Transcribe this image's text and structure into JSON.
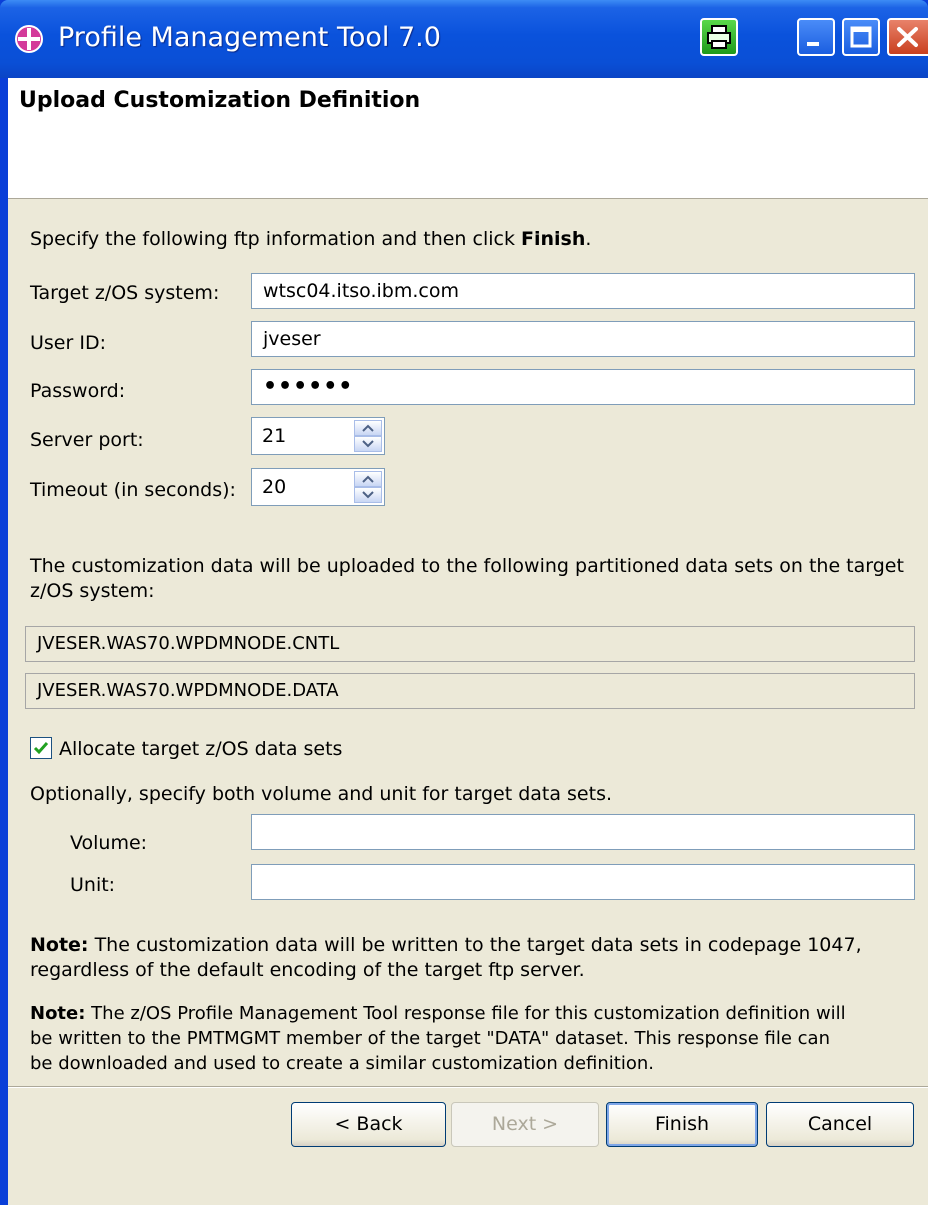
{
  "window": {
    "title": "Profile Management Tool 7.0"
  },
  "header": {
    "title": "Upload Customization Definition"
  },
  "instructions": {
    "prefix": "Specify the following ftp information and then click ",
    "bold": "Finish",
    "suffix": "."
  },
  "form": {
    "target_label": "Target z/OS system:",
    "target_value": "wtsc04.itso.ibm.com",
    "userid_label": "User ID:",
    "userid_value": "jveser",
    "password_label": "Password:",
    "password_value": "••••••",
    "port_label": "Server port:",
    "port_value": "21",
    "timeout_label": "Timeout (in seconds):",
    "timeout_value": "20"
  },
  "datasets": {
    "description_line1": "The customization data will be uploaded to the following partitioned data sets on the target",
    "description_line2": "z/OS system:",
    "cntl": "JVESER.WAS70.WPDMNODE.CNTL",
    "data": "JVESER.WAS70.WPDMNODE.DATA"
  },
  "allocate": {
    "label": "Allocate target z/OS data sets",
    "checked": true,
    "optional_text": "Optionally, specify both volume and unit for target data sets.",
    "volume_label": "Volume:",
    "volume_value": "",
    "unit_label": "Unit:",
    "unit_value": ""
  },
  "notes": {
    "note_label": "Note:",
    "note1_line1": " The customization data will be written to the target data sets in codepage 1047,",
    "note1_line2": "regardless of the default encoding of the target ftp server.",
    "note2_line1": " The z/OS Profile Management Tool response file for this customization definition will",
    "note2_line2": "be written to the PMTMGMT member of the target \"DATA\" dataset. This response file can",
    "note2_line3": "be downloaded and used to create a similar customization definition."
  },
  "buttons": {
    "back": "< Back",
    "next": "Next >",
    "finish": "Finish",
    "cancel": "Cancel"
  },
  "colors": {
    "titlebar": "#0a52dc",
    "dialog_bg": "#ece9d8",
    "field_border": "#7f9db9"
  }
}
